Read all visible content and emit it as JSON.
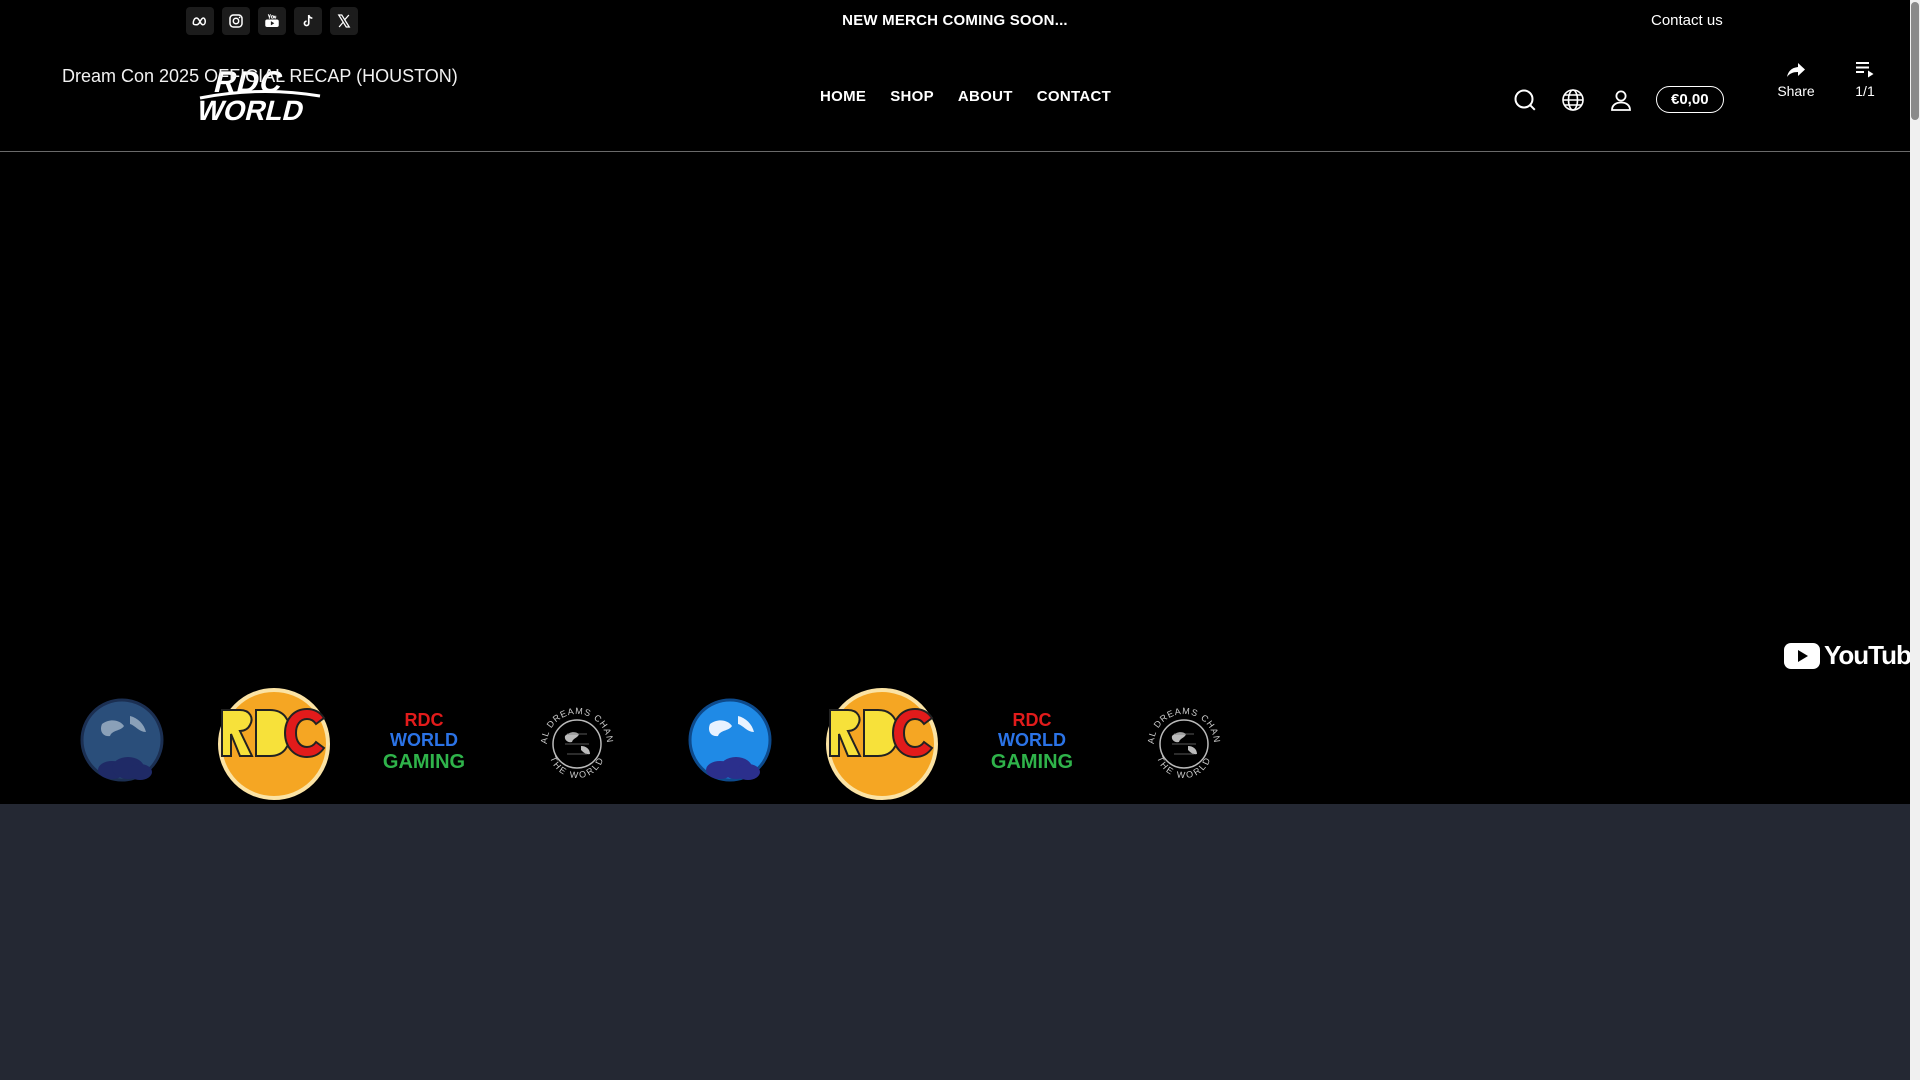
{
  "topbar": {
    "socials": [
      {
        "name": "meta-icon"
      },
      {
        "name": "instagram-icon"
      },
      {
        "name": "youtube-icon"
      },
      {
        "name": "tiktok-icon"
      },
      {
        "name": "x-icon"
      }
    ],
    "announcement": "NEW MERCH COMING SOON...",
    "contact_label": "Contact us"
  },
  "header": {
    "logo_text": "RDC WORLD",
    "video_title": "Dream Con 2025 OFFICIAL RECAP (HOUSTON)",
    "nav": [
      "HOME",
      "SHOP",
      "ABOUT",
      "CONTACT"
    ],
    "cart_total": "€0,00",
    "share_label": "Share",
    "playlist_count": "1/1"
  },
  "video": {
    "brand": "YouTube"
  },
  "strip": {
    "gaming_lines": [
      "RDC",
      "WORLD",
      "GAMING"
    ],
    "badge_lines": [
      "REAL DREAMS CHANGE",
      "THE WORLD"
    ]
  },
  "colors": {
    "background": "#000000",
    "bottom_panel": "#242833",
    "youtube_red": "#ff0000"
  }
}
